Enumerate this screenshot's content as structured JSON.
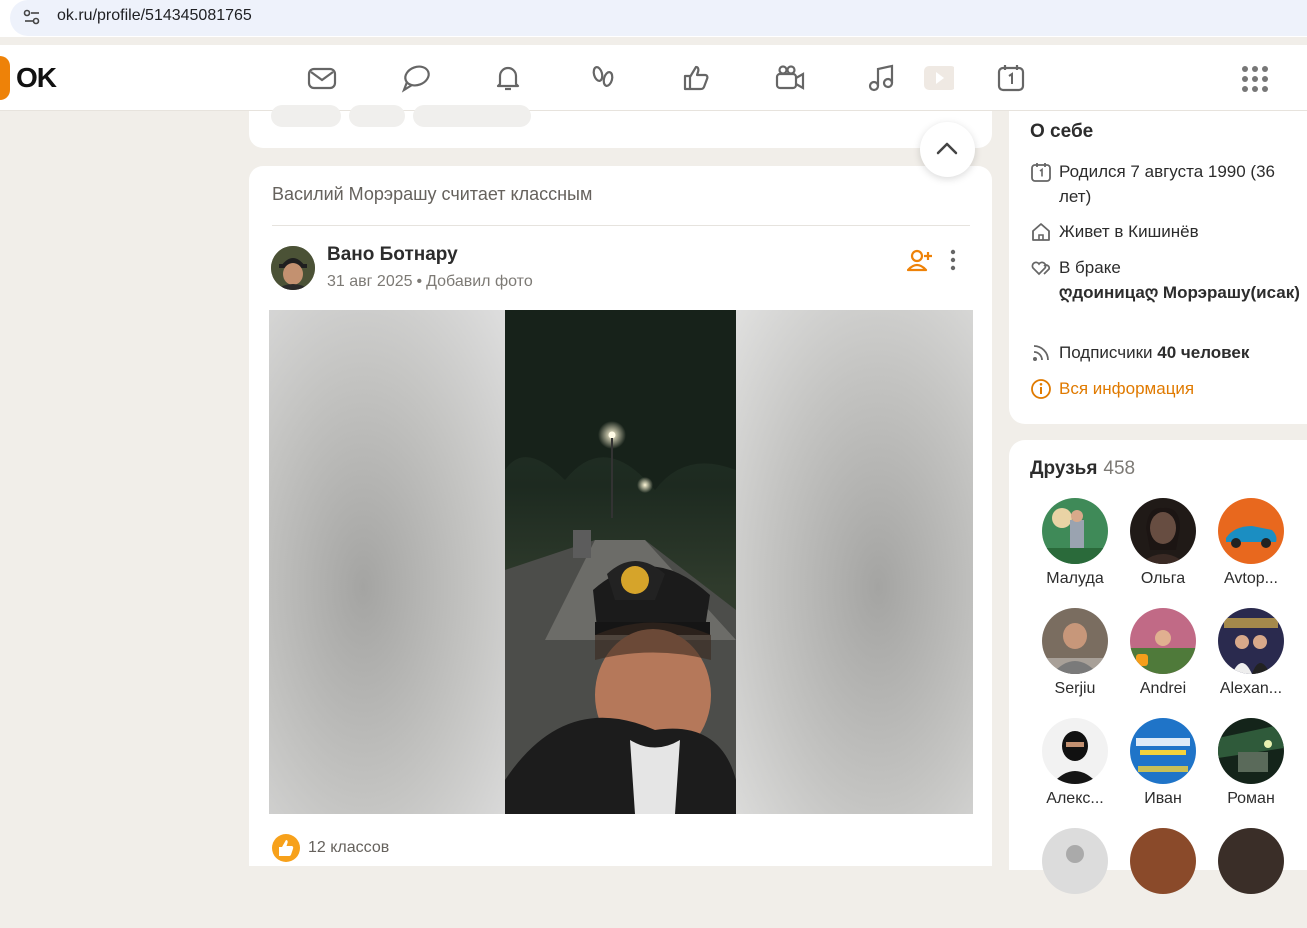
{
  "browser": {
    "url": "ok.ru/profile/514345081765"
  },
  "header": {
    "logo": "OK",
    "nav_icons": [
      "mail-icon",
      "chat-icon",
      "bell-icon",
      "footprints-icon",
      "like-icon",
      "video-camera-icon",
      "music-icon",
      "play-icon",
      "calendar-icon"
    ],
    "apps_icon": "apps-grid-icon"
  },
  "feed": {
    "header_text": "Василий Морэрашу считает классным",
    "post": {
      "author": "Вано Ботнару",
      "date": "31 авг 2025",
      "action": "Добавил фото",
      "likes_text": "12 классов"
    }
  },
  "about": {
    "title": "О себе",
    "born": "Родился 7 августа 1990 (36 лет)",
    "lives": "Живет в Кишинёв",
    "married_label": "В браке",
    "married_with": "ღдоиницаღ Морэрашу(исак)",
    "subscribers_label": "Подписчики",
    "subscribers_count": "40 человек",
    "all_info": "Вся информация"
  },
  "friends": {
    "title": "Друзья",
    "count": "458",
    "items": [
      {
        "name": "Малуда",
        "color": "#4c8a5c"
      },
      {
        "name": "Ольга",
        "color": "#2a2320"
      },
      {
        "name": "Avtop...",
        "color": "#e2611c"
      },
      {
        "name": "Serjiu",
        "color": "#6f655b"
      },
      {
        "name": "Andrei",
        "color": "#b4657a"
      },
      {
        "name": "Alexan...",
        "color": "#2b2b4a"
      },
      {
        "name": "Алекс...",
        "color": "#222222"
      },
      {
        "name": "Иван",
        "color": "#2a73c4"
      },
      {
        "name": "Роман",
        "color": "#1e3a2a"
      }
    ]
  },
  "colors": {
    "accent": "#ee8208",
    "orange_text": "#e07a00",
    "like": "#f7a11b"
  }
}
